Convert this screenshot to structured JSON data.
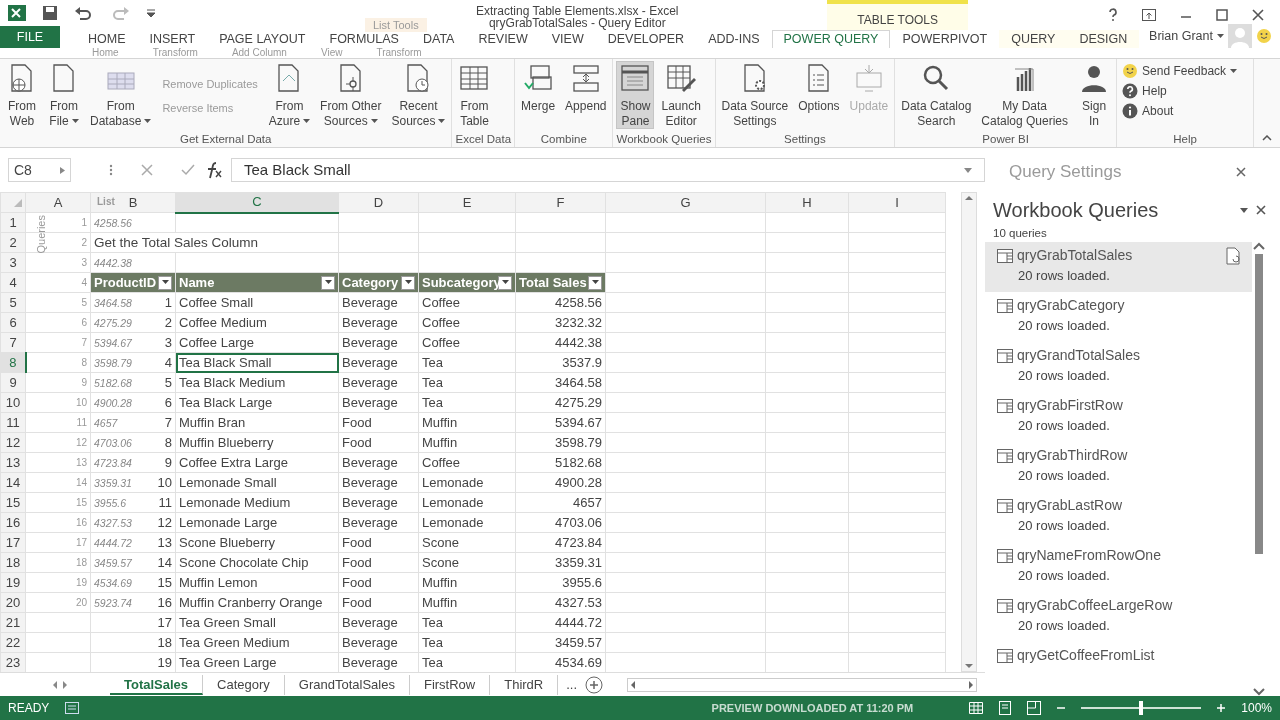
{
  "window": {
    "title": "Extracting Table Elements.xlsx - Excel",
    "context_group": "TABLE TOOLS",
    "user": "Brian Grant"
  },
  "ribbon_tabs": [
    {
      "label": "FILE",
      "kind": "file",
      "selected": false
    },
    {
      "label": "HOME",
      "kind": "tab",
      "selected": false
    },
    {
      "label": "INSERT",
      "kind": "tab",
      "selected": false
    },
    {
      "label": "PAGE LAYOUT",
      "kind": "tab",
      "selected": false
    },
    {
      "label": "FORMULAS",
      "kind": "tab",
      "selected": false
    },
    {
      "label": "DATA",
      "kind": "tab",
      "selected": false
    },
    {
      "label": "REVIEW",
      "kind": "tab",
      "selected": false
    },
    {
      "label": "VIEW",
      "kind": "tab",
      "selected": false
    },
    {
      "label": "DEVELOPER",
      "kind": "tab",
      "selected": false
    },
    {
      "label": "ADD-INS",
      "kind": "tab",
      "selected": false
    },
    {
      "label": "POWER QUERY",
      "kind": "tab",
      "selected": true
    },
    {
      "label": "POWERPIVOT",
      "kind": "tab",
      "selected": false
    },
    {
      "label": "QUERY",
      "kind": "context",
      "selected": false
    },
    {
      "label": "DESIGN",
      "kind": "context",
      "selected": false
    }
  ],
  "ribbon_groups": [
    {
      "label": "Get External Data",
      "buttons": [
        {
          "lines": [
            "From",
            "Web"
          ],
          "menu": false,
          "selected": false,
          "disabled": false
        },
        {
          "lines": [
            "From",
            "File"
          ],
          "menu": true,
          "selected": false,
          "disabled": false
        },
        {
          "lines": [
            "From",
            "Database"
          ],
          "menu": true,
          "selected": false,
          "disabled": false
        },
        {
          "lines": [
            "From",
            "Azure"
          ],
          "menu": true,
          "selected": false,
          "disabled": false
        },
        {
          "lines": [
            "From Other",
            "Sources"
          ],
          "menu": true,
          "selected": false,
          "disabled": false
        },
        {
          "lines": [
            "Recent",
            "Sources"
          ],
          "menu": true,
          "selected": false,
          "disabled": false
        }
      ]
    },
    {
      "label": "Excel Data",
      "buttons": [
        {
          "lines": [
            "From",
            "Table"
          ],
          "menu": false,
          "selected": false,
          "disabled": false
        }
      ]
    },
    {
      "label": "Combine",
      "buttons": [
        {
          "lines": [
            "Merge"
          ],
          "menu": false,
          "selected": false,
          "disabled": false
        },
        {
          "lines": [
            "Append"
          ],
          "menu": false,
          "selected": false,
          "disabled": false
        }
      ]
    },
    {
      "label": "Workbook Queries",
      "buttons": [
        {
          "lines": [
            "Show",
            "Pane"
          ],
          "menu": false,
          "selected": true,
          "disabled": false
        },
        {
          "lines": [
            "Launch",
            "Editor"
          ],
          "menu": false,
          "selected": false,
          "disabled": false
        }
      ]
    },
    {
      "label": "Settings",
      "buttons": [
        {
          "lines": [
            "Data Source",
            "Settings"
          ],
          "menu": false,
          "selected": false,
          "disabled": false
        },
        {
          "lines": [
            "Options"
          ],
          "menu": false,
          "selected": false,
          "disabled": false
        },
        {
          "lines": [
            "Update"
          ],
          "menu": false,
          "selected": false,
          "disabled": true
        }
      ]
    },
    {
      "label": "Power BI",
      "buttons": [
        {
          "lines": [
            "Data Catalog",
            "Search"
          ],
          "menu": false,
          "selected": false,
          "disabled": false
        },
        {
          "lines": [
            "My Data",
            "Catalog Queries"
          ],
          "menu": false,
          "selected": false,
          "disabled": false
        },
        {
          "lines": [
            "Sign",
            "In"
          ],
          "menu": false,
          "selected": false,
          "disabled": false
        }
      ]
    },
    {
      "label": "Help",
      "small_buttons": [
        {
          "label": "Send Feedback",
          "menu": true
        },
        {
          "label": "Help",
          "menu": false
        },
        {
          "label": "About",
          "menu": false
        }
      ]
    }
  ],
  "query_editor_ghost": {
    "window_title": "qryGrabTotalSales - Query Editor",
    "context_tab": "List Tools",
    "tabs": [
      "Home",
      "Transform",
      "Add Column",
      "View",
      "Transform"
    ],
    "ribbon_items": [
      "Remove Duplicates",
      "Reverse Items"
    ],
    "list_header": "List",
    "pane_label": "Queries",
    "settings_title": "Query Settings",
    "preview_status": "PREVIEW DOWNLOADED AT 11:20 PM"
  },
  "grid": {
    "name_box": "C8",
    "formula": "Tea Black Small",
    "columns": [
      {
        "letter": "A",
        "selected": false
      },
      {
        "letter": "B",
        "selected": false
      },
      {
        "letter": "C",
        "selected": true
      },
      {
        "letter": "D",
        "selected": false
      },
      {
        "letter": "E",
        "selected": false
      },
      {
        "letter": "F",
        "selected": false
      },
      {
        "letter": "G",
        "selected": false
      },
      {
        "letter": "H",
        "selected": false
      },
      {
        "letter": "I",
        "selected": false
      }
    ],
    "rows": [
      {
        "number": "1",
        "kind": "blank",
        "selected": false,
        "list_index": "1",
        "list_value": "4258.56"
      },
      {
        "number": "2",
        "kind": "title",
        "selected": false,
        "list_index": "2",
        "text": "Get the Total Sales Column"
      },
      {
        "number": "3",
        "kind": "blank",
        "selected": false,
        "list_index": "3",
        "list_value": "4442.38"
      },
      {
        "number": "4",
        "kind": "header",
        "selected": false,
        "list_index": "4",
        "headers": [
          "ProductID",
          "Name",
          "Category",
          "Subcategory",
          "Total Sales"
        ]
      },
      {
        "number": "5",
        "kind": "data",
        "selected": false,
        "list_index": "5",
        "list_value": "3464.58",
        "cells": [
          "1",
          "Coffee Small",
          "Beverage",
          "Coffee",
          "4258.56"
        ]
      },
      {
        "number": "6",
        "kind": "data",
        "selected": false,
        "list_index": "6",
        "list_value": "4275.29",
        "cells": [
          "2",
          "Coffee Medium",
          "Beverage",
          "Coffee",
          "3232.32"
        ]
      },
      {
        "number": "7",
        "kind": "data",
        "selected": false,
        "list_index": "7",
        "list_value": "5394.67",
        "cells": [
          "3",
          "Coffee Large",
          "Beverage",
          "Coffee",
          "4442.38"
        ]
      },
      {
        "number": "8",
        "kind": "data",
        "selected": true,
        "list_index": "8",
        "list_value": "3598.79",
        "cells": [
          "4",
          "Tea Black Small",
          "Beverage",
          "Tea",
          "3537.9"
        ]
      },
      {
        "number": "9",
        "kind": "data",
        "selected": false,
        "list_index": "9",
        "list_value": "5182.68",
        "cells": [
          "5",
          "Tea Black Medium",
          "Beverage",
          "Tea",
          "3464.58"
        ]
      },
      {
        "number": "10",
        "kind": "data",
        "selected": false,
        "list_index": "10",
        "list_value": "4900.28",
        "cells": [
          "6",
          "Tea Black Large",
          "Beverage",
          "Tea",
          "4275.29"
        ]
      },
      {
        "number": "11",
        "kind": "data",
        "selected": false,
        "list_index": "11",
        "list_value": "4657",
        "cells": [
          "7",
          "Muffin Bran",
          "Food",
          "Muffin",
          "5394.67"
        ]
      },
      {
        "number": "12",
        "kind": "data",
        "selected": false,
        "list_index": "12",
        "list_value": "4703.06",
        "cells": [
          "8",
          "Muffin Blueberry",
          "Food",
          "Muffin",
          "3598.79"
        ]
      },
      {
        "number": "13",
        "kind": "data",
        "selected": false,
        "list_index": "13",
        "list_value": "4723.84",
        "cells": [
          "9",
          "Coffee Extra Large",
          "Beverage",
          "Coffee",
          "5182.68"
        ]
      },
      {
        "number": "14",
        "kind": "data",
        "selected": false,
        "list_index": "14",
        "list_value": "3359.31",
        "cells": [
          "10",
          "Lemonade Small",
          "Beverage",
          "Lemonade",
          "4900.28"
        ]
      },
      {
        "number": "15",
        "kind": "data",
        "selected": false,
        "list_index": "15",
        "list_value": "3955.6",
        "cells": [
          "11",
          "Lemonade Medium",
          "Beverage",
          "Lemonade",
          "4657"
        ]
      },
      {
        "number": "16",
        "kind": "data",
        "selected": false,
        "list_index": "16",
        "list_value": "4327.53",
        "cells": [
          "12",
          "Lemonade Large",
          "Beverage",
          "Lemonade",
          "4703.06"
        ]
      },
      {
        "number": "17",
        "kind": "data",
        "selected": false,
        "list_index": "17",
        "list_value": "4444.72",
        "cells": [
          "13",
          "Scone Blueberry",
          "Food",
          "Scone",
          "4723.84"
        ]
      },
      {
        "number": "18",
        "kind": "data",
        "selected": false,
        "list_index": "18",
        "list_value": "3459.57",
        "cells": [
          "14",
          "Scone Chocolate Chip",
          "Food",
          "Scone",
          "3359.31"
        ]
      },
      {
        "number": "19",
        "kind": "data",
        "selected": false,
        "list_index": "19",
        "list_value": "4534.69",
        "cells": [
          "15",
          "Muffin Lemon",
          "Food",
          "Muffin",
          "3955.6"
        ]
      },
      {
        "number": "20",
        "kind": "data",
        "selected": false,
        "list_index": "20",
        "list_value": "5923.74",
        "cells": [
          "16",
          "Muffin Cranberry Orange",
          "Food",
          "Muffin",
          "4327.53"
        ]
      },
      {
        "number": "21",
        "kind": "data",
        "selected": false,
        "cells": [
          "17",
          "Tea Green Small",
          "Beverage",
          "Tea",
          "4444.72"
        ]
      },
      {
        "number": "22",
        "kind": "data",
        "selected": false,
        "cells": [
          "18",
          "Tea Green Medium",
          "Beverage",
          "Tea",
          "3459.57"
        ]
      },
      {
        "number": "23",
        "kind": "data",
        "selected": false,
        "cells": [
          "19",
          "Tea Green Large",
          "Beverage",
          "Tea",
          "4534.69"
        ]
      }
    ]
  },
  "sheet_tabs": [
    {
      "label": "TotalSales",
      "selected": true
    },
    {
      "label": "Category",
      "selected": false
    },
    {
      "label": "GrandTotalSales",
      "selected": false
    },
    {
      "label": "FirstRow",
      "selected": false
    },
    {
      "label": "ThirdR",
      "selected": false
    }
  ],
  "sheet_tabs_more": "...",
  "workbook_queries": {
    "title": "Workbook Queries",
    "count": "10 queries",
    "queries": [
      {
        "name": "qryGrabTotalSales",
        "status": "20 rows loaded.",
        "selected": true
      },
      {
        "name": "qryGrabCategory",
        "status": "20 rows loaded.",
        "selected": false
      },
      {
        "name": "qryGrandTotalSales",
        "status": "20 rows loaded.",
        "selected": false
      },
      {
        "name": "qryGrabFirstRow",
        "status": "20 rows loaded.",
        "selected": false
      },
      {
        "name": "qryGrabThirdRow",
        "status": "20 rows loaded.",
        "selected": false
      },
      {
        "name": "qryGrabLastRow",
        "status": "20 rows loaded.",
        "selected": false
      },
      {
        "name": "qryNameFromRowOne",
        "status": "20 rows loaded.",
        "selected": false
      },
      {
        "name": "qryGrabCoffeeLargeRow",
        "status": "20 rows loaded.",
        "selected": false
      },
      {
        "name": "qryGetCoffeeFromList",
        "selected": false
      }
    ]
  },
  "status_bar": {
    "mode": "READY",
    "zoom": "100%",
    "zoom_slider": {
      "level": 0.5
    }
  }
}
